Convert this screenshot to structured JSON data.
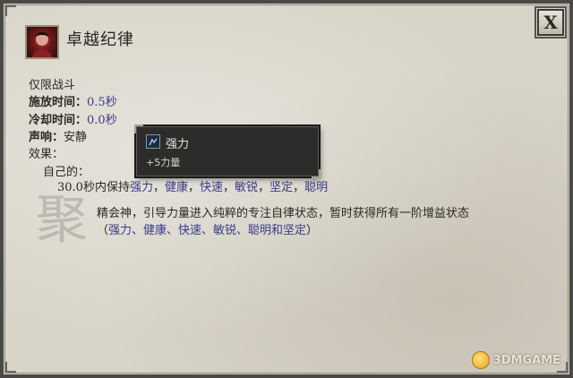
{
  "window": {
    "close_label": "X"
  },
  "ability": {
    "title": "卓越纪律",
    "combat_only": "仅限战斗",
    "cast_time_label": "施放时间：",
    "cast_time_value": "0.5秒",
    "cooldown_label": "冷却时间：",
    "cooldown_value": "0.0秒",
    "sound_label": "声响：",
    "sound_value": "安静",
    "effects_label": "效果：",
    "self_label": "自己的：",
    "duration_text": "30.0秒内保持",
    "buffs": [
      "强力",
      "健康",
      "快速",
      "敏锐",
      "坚定",
      "聪明"
    ],
    "separator": "，",
    "description_line1": "精会神，引导力量进入纯粹的专注自律状态，暂时获得所有一阶增益状态",
    "description_line2_open": "（",
    "description_line2_buffs": "强力、健康、快速、敏锐、聪明和坚定",
    "description_line2_close": "）",
    "watermark_glyph": "聚"
  },
  "tooltip": {
    "title": "强力",
    "description": "+5力量",
    "icon": "strength-icon"
  },
  "watermark": {
    "logo": "3DMGAME",
    "icon": "smiley-face-icon"
  },
  "colors": {
    "parchment": "#d8d4c8",
    "value_blue": "#3b3a8a",
    "tooltip_bg": "#2c2c2a"
  }
}
